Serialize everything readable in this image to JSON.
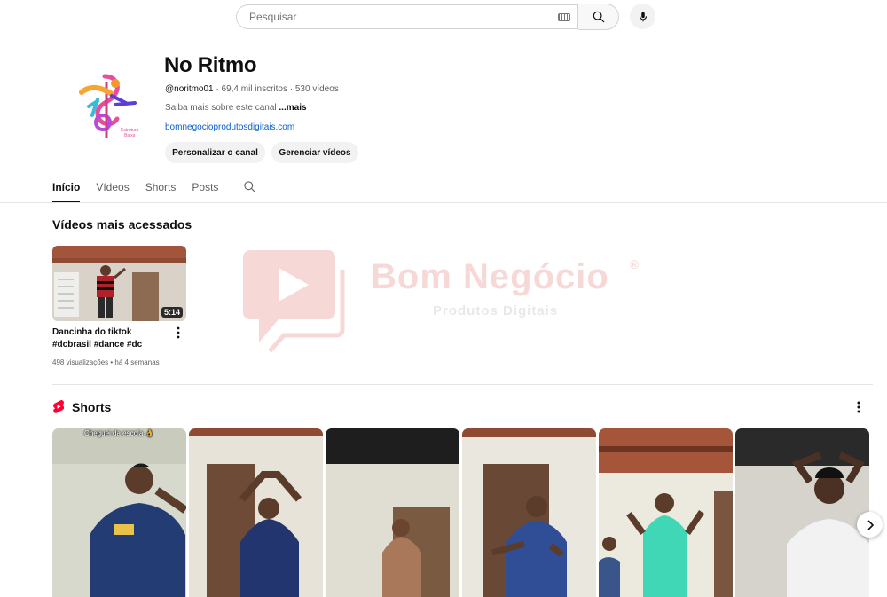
{
  "search": {
    "placeholder": "Pesquisar"
  },
  "channel": {
    "name": "No Ritmo",
    "handle": "@noritmo01",
    "subscribers": "69,4 mil inscritos",
    "video_count": "530 vídeos",
    "separator": " · ",
    "about": "Saiba mais sobre este canal ",
    "about_more": "...mais",
    "link": "bomnegocioprodutosdigitais.com",
    "buttons": {
      "customize": "Personalizar o canal",
      "manage": "Gerenciar vídeos"
    }
  },
  "tabs": [
    {
      "label": "Início",
      "active": true
    },
    {
      "label": "Vídeos",
      "active": false
    },
    {
      "label": "Shorts",
      "active": false
    },
    {
      "label": "Posts",
      "active": false
    }
  ],
  "popular": {
    "title": "Vídeos mais acessados",
    "video": {
      "title": "Dancinha do tiktok #dcbrasil #dance #dc",
      "duration": "5:14",
      "stats": "498 visualizações • há 4 semanas"
    }
  },
  "watermark": {
    "brand": "Bom Negócio",
    "sub": "Produtos Digitais",
    "mark": "®"
  },
  "shorts": {
    "title": "Shorts",
    "first_caption": "Cheguei da escola 👌"
  },
  "colors": {
    "link": "#065fd4",
    "shorts_red": "#ff0033",
    "pill_bg": "#f2f2f2",
    "watermark": "#d9534f"
  },
  "icons": [
    "search-icon",
    "keyboard-icon",
    "mic-icon",
    "more-vert-icon",
    "shorts-logo-icon",
    "chevron-right-icon"
  ]
}
